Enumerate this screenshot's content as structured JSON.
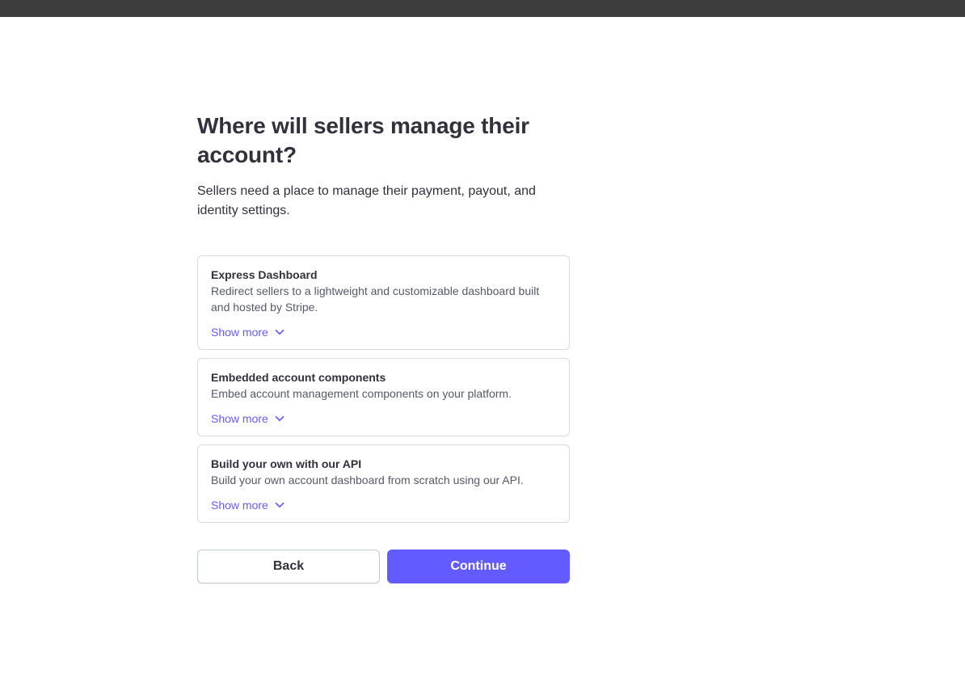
{
  "colors": {
    "accent": "#635bff",
    "topbar": "#3c3c3c",
    "text": "#30313d",
    "muted_text": "#545969",
    "border": "#d5dbe1"
  },
  "page": {
    "title": "Where will sellers manage their account?",
    "subtitle": "Sellers need a place to manage their payment, payout, and identity settings."
  },
  "options": [
    {
      "title": "Express Dashboard",
      "description": "Redirect sellers to a lightweight and customizable dashboard built and hosted by Stripe.",
      "show_more": "Show more",
      "icon": "chevron-down-icon"
    },
    {
      "title": "Embedded account components",
      "description": "Embed account management components on your platform.",
      "show_more": "Show more",
      "icon": "chevron-down-icon"
    },
    {
      "title": "Build your own with our API",
      "description": "Build your own account dashboard from scratch using our API.",
      "show_more": "Show more",
      "icon": "chevron-down-icon"
    }
  ],
  "buttons": {
    "back": "Back",
    "continue": "Continue"
  }
}
